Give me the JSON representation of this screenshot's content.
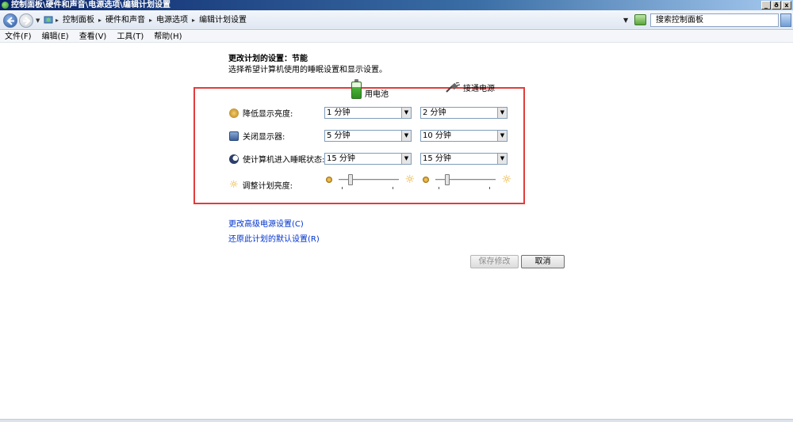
{
  "window": {
    "title": "控制面板\\硬件和声音\\电源选项\\编辑计划设置",
    "buttons": [
      "_",
      "ð",
      "x"
    ]
  },
  "address": {
    "crumbs": [
      "控制面板",
      "硬件和声音",
      "电源选项",
      "编辑计划设置"
    ],
    "search_placeholder": "搜索控制面板"
  },
  "menu": [
    "文件(F)",
    "编辑(E)",
    "查看(V)",
    "工具(T)",
    "帮助(H)"
  ],
  "page": {
    "heading": "更改计划的设置：节能",
    "subheading": "选择希望计算机使用的睡眠设置和显示设置。"
  },
  "columns": {
    "battery": "用电池",
    "plugged": "接通电源"
  },
  "settings": [
    {
      "label": "降低显示亮度:",
      "battery": "1 分钟",
      "plugged": "2 分钟"
    },
    {
      "label": "关闭显示器:",
      "battery": "5 分钟",
      "plugged": "10 分钟"
    },
    {
      "label": "使计算机进入睡眠状态:",
      "battery": "15 分钟",
      "plugged": "15 分钟"
    }
  ],
  "brightness": {
    "label": "调整计划亮度:",
    "battery_level": 0.2,
    "plugged_level": 0.2
  },
  "links": {
    "advanced": "更改高级电源设置(C)",
    "restore": "还原此计划的默认设置(R)"
  },
  "actions": {
    "save": "保存修改",
    "cancel": "取消"
  },
  "colors": {
    "highlight_frame": "#e23c3c",
    "link": "#0033cc"
  }
}
